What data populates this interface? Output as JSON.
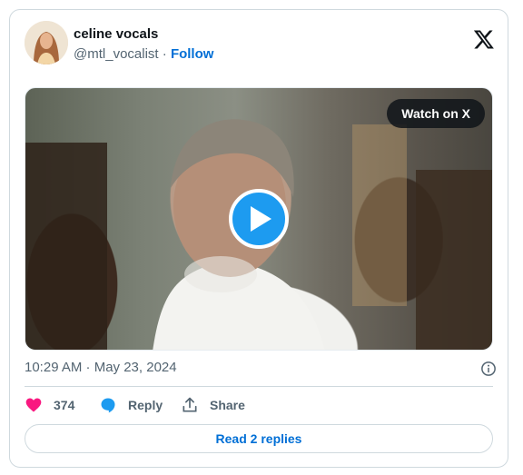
{
  "author": {
    "display_name": "celine vocals",
    "handle": "@mtl_vocalist",
    "separator": " · ",
    "follow_label": "Follow"
  },
  "media": {
    "watch_label": "Watch on X"
  },
  "meta": {
    "timestamp": "10:29 AM · May 23, 2024"
  },
  "actions": {
    "like_count": "374",
    "reply_label": "Reply",
    "share_label": "Share"
  },
  "footer": {
    "read_replies_label": "Read 2 replies"
  },
  "colors": {
    "accent": "#1d9bf0",
    "link": "#006fd6",
    "like": "#f91880",
    "muted_text": "#536471",
    "border": "#cfd9de"
  },
  "icons": [
    "avatar",
    "x-logo-icon",
    "play-icon",
    "info-icon",
    "heart-icon",
    "reply-bubble-icon",
    "share-icon"
  ]
}
